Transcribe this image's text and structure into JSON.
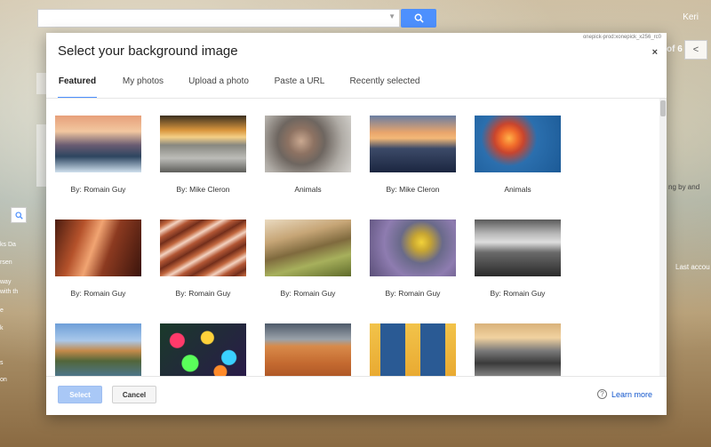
{
  "background": {
    "user_name": "Keri",
    "pager_text": "of 6",
    "pager_prev": "<",
    "right_fragments": [
      "ng by and",
      "Last accou"
    ],
    "left_fragments": [
      "ks Da",
      "rsen",
      "way",
      "with th",
      "e",
      "k",
      "s",
      "on"
    ]
  },
  "dialog": {
    "build_id": "onepick-prod:xonepick_x256_rc0",
    "title": "Select your background image",
    "close_label": "×",
    "tabs": [
      {
        "label": "Featured",
        "active": true
      },
      {
        "label": "My photos",
        "active": false
      },
      {
        "label": "Upload a photo",
        "active": false
      },
      {
        "label": "Paste a URL",
        "active": false
      },
      {
        "label": "Recently selected",
        "active": false
      }
    ],
    "images": [
      {
        "caption": "By: Romain Guy",
        "subject": "sunset lake with trees"
      },
      {
        "caption": "By: Mike Cleron",
        "subject": "sunset above clouds"
      },
      {
        "caption": "Animals",
        "subject": "snow monkey"
      },
      {
        "caption": "By: Mike Cleron",
        "subject": "sunset over mountains"
      },
      {
        "caption": "Animals",
        "subject": "jellyfish"
      },
      {
        "caption": "By: Romain Guy",
        "subject": "slot canyon"
      },
      {
        "caption": "By: Romain Guy",
        "subject": "sandstone waves"
      },
      {
        "caption": "By: Romain Guy",
        "subject": "wood close-up"
      },
      {
        "caption": "By: Romain Guy",
        "subject": "yellow flowers"
      },
      {
        "caption": "By: Romain Guy",
        "subject": "black and white landscape"
      },
      {
        "caption": "",
        "subject": "castle by river"
      },
      {
        "caption": "",
        "subject": "colorful glass"
      },
      {
        "caption": "",
        "subject": "red sand dunes"
      },
      {
        "caption": "",
        "subject": "blue window shutters"
      },
      {
        "caption": "",
        "subject": "rocky coast sunset"
      }
    ],
    "select_label": "Select",
    "cancel_label": "Cancel",
    "help_icon": "?",
    "learn_more_label": "Learn more"
  },
  "colors": {
    "accent": "#4d90fe",
    "link": "#1155cc",
    "select_disabled": "#a9c8f6"
  }
}
